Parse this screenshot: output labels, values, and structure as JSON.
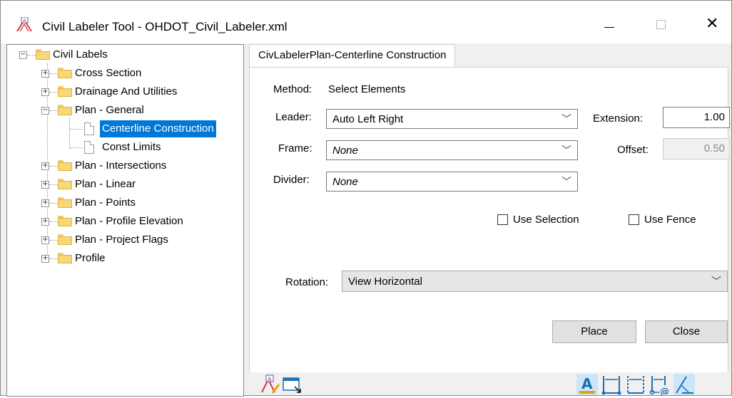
{
  "window": {
    "title": "Civil Labeler Tool - OHDOT_Civil_Labeler.xml",
    "icon": "civil-labeler-app-icon"
  },
  "controls": {
    "minimize_icon": "minimize-icon",
    "maximize_icon": "maximize-icon",
    "close_icon": "close-icon"
  },
  "tree": {
    "root": "Civil Labels",
    "items": [
      {
        "label": "Cross Section",
        "expanded": false
      },
      {
        "label": "Drainage And Utilities",
        "expanded": false
      },
      {
        "label": "Plan - General",
        "expanded": true,
        "children": [
          {
            "label": "Centerline Construction",
            "selected": true
          },
          {
            "label": "Const Limits",
            "selected": false
          }
        ]
      },
      {
        "label": "Plan - Intersections",
        "expanded": false
      },
      {
        "label": "Plan - Linear",
        "expanded": false
      },
      {
        "label": "Plan - Points",
        "expanded": false
      },
      {
        "label": "Plan - Profile Elevation",
        "expanded": false
      },
      {
        "label": "Plan - Project Flags",
        "expanded": false
      },
      {
        "label": "Profile",
        "expanded": false
      }
    ]
  },
  "tab": {
    "label": "CivLabelerPlan-Centerline Construction"
  },
  "form": {
    "method_label": "Method:",
    "method_value": "Select Elements",
    "leader_label": "Leader:",
    "leader_value": "Auto Left Right",
    "frame_label": "Frame:",
    "frame_value": "None",
    "divider_label": "Divider:",
    "divider_value": "None",
    "extension_label": "Extension:",
    "extension_value": "1.00",
    "offset_label": "Offset:",
    "offset_value": "0.50",
    "use_selection_label": "Use Selection",
    "use_fence_label": "Use Fence",
    "rotation_label": "Rotation:",
    "rotation_value": "View Horizontal"
  },
  "buttons": {
    "place": "Place",
    "close": "Close"
  },
  "toolbar": {
    "left_icons": [
      "edit-label-icon",
      "select-window-icon"
    ],
    "right_icons": [
      "text-style-icon",
      "dimension-icon",
      "dimension-dashed-icon",
      "dimension-at-icon",
      "angle-icon"
    ]
  },
  "colors": {
    "selection": "#0078d7",
    "folder": "#f8d775",
    "icon_highlight": "#cde6f7",
    "icon_blue": "#1a6fb5"
  }
}
